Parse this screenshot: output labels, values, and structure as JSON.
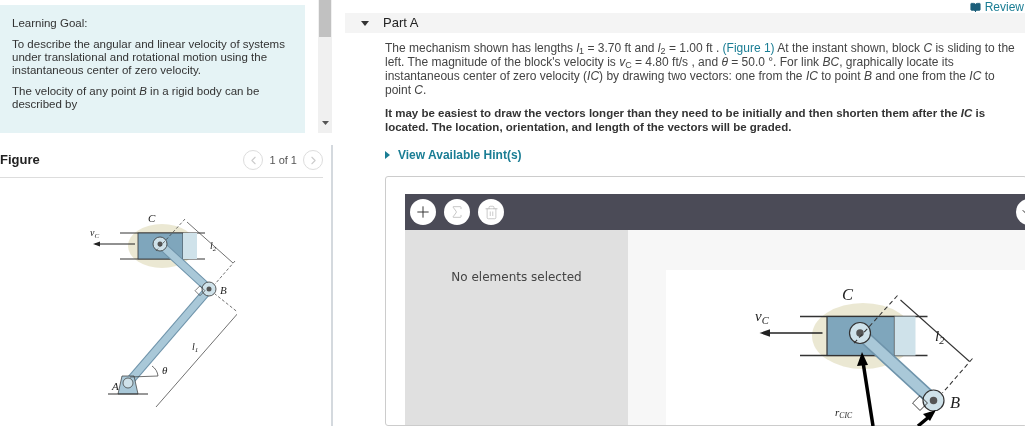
{
  "learning_goal": {
    "title": "Learning Goal:",
    "paragraphs": [
      "To describe the angular and linear velocity of systems under translational and rotational motion using the instantaneous center of zero velocity.",
      "The velocity of any point *B* in a rigid body can be described by"
    ]
  },
  "figure_panel": {
    "title": "Figure",
    "pager": "1 of 1",
    "prev_disabled": true,
    "next_disabled": true,
    "labels": {
      "velocity": [
        "v",
        "C"
      ],
      "point_c": "C",
      "length_2": [
        "l",
        "2"
      ],
      "point_b": "B",
      "length_1": [
        "l",
        "1"
      ],
      "angle": "θ",
      "point_a": "A"
    }
  },
  "review_link": "Review",
  "part": {
    "title": "Part A",
    "expanded": true,
    "problem": {
      "before": "The mechanism shown has lengths *l*$_{1}$ = 3.70 ft and *l*$_{2}$ = 1.00 ft . ",
      "link": "(Figure 1)",
      "after": " At the instant shown, block *C* is sliding to the left. The magnitude of the block's velocity is *v*$_{C}$ = 4.80 ft/s , and *θ* = 50.0 °. For link *BC*, graphically locate its instantaneous center of zero velocity (*IC*) by drawing two vectors: one from the *IC* to point *B* and one from the *IC* to point *C*."
    },
    "instruction": "It may be easiest to draw the vectors longer than they need to be initially and then shorten them after the *IC* is located. The location, orientation, and length of the vectors will be graded.",
    "hint_link": "View Available Hint(s)",
    "tool": {
      "status": "No elements selected",
      "labels": {
        "velocity": [
          "v",
          "C"
        ],
        "point_c": "C",
        "length_2": [
          "l",
          "2"
        ],
        "point_b": "B"
      },
      "vector_label": [
        "r",
        "CIC"
      ]
    }
  }
}
